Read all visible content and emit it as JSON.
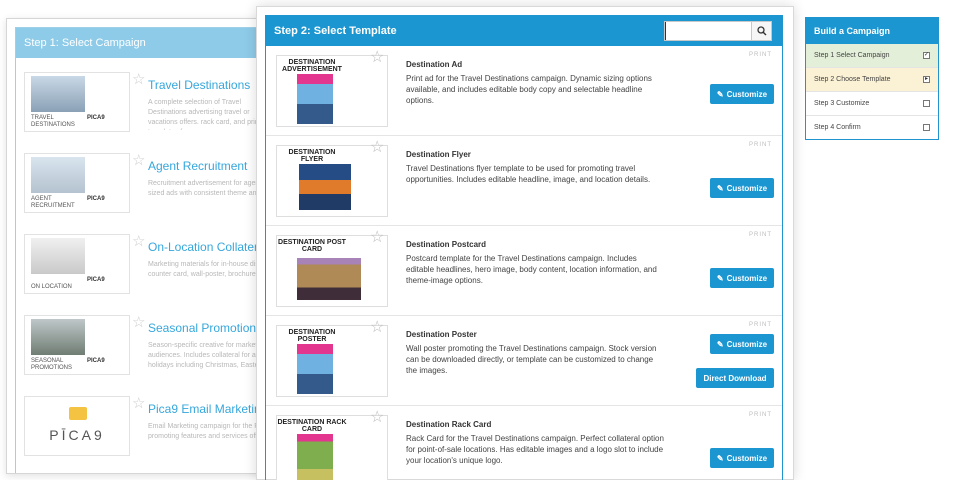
{
  "step1": {
    "header": "Step 1: Select Campaign",
    "campaigns": [
      {
        "title": "Travel Destinations",
        "caption": "TRAVEL DESTINATIONS",
        "brand": "PICA9",
        "desc": "A complete selection of Travel Destinations advertising travel or vacations offers. rack card, and print ad templates for"
      },
      {
        "title": "Agent Recruitment",
        "caption": "AGENT RECRUITMENT",
        "brand": "PICA9",
        "desc": "Recruitment advertisement for agent sized ads with consistent theme and"
      },
      {
        "title": "On-Location Collateral",
        "caption": "ON LOCATION",
        "brand": "PICA9",
        "desc": "Marketing materials for in-house disp counter card, wall-poster, brochure,"
      },
      {
        "title": "Seasonal Promotions",
        "caption": "SEASONAL PROMOTIONS",
        "brand": "PICA9",
        "desc": "Season-specific creative for marketi audiences. Includes collateral for all f holidays including Christmas, Easter"
      },
      {
        "title": "Pica9 Email Marketing",
        "logo_text": "PĪCA9",
        "desc": "Email Marketing campaign for the Pica promoting features and services offe"
      }
    ]
  },
  "step2": {
    "header": "Step 2: Select Template",
    "search": {
      "value": "",
      "placeholder": ""
    },
    "customize_label": "Customize",
    "download_label": "Direct Download",
    "templates": [
      {
        "thumb_title": "DESTINATION ADVERTISEMENT",
        "name": "Destination Ad",
        "tag": "PRINT",
        "desc": "Print ad for the Travel Destinations campaign. Dynamic sizing options available, and includes editable body copy and selectable headline options."
      },
      {
        "thumb_title": "DESTINATION FLYER",
        "name": "Destination Flyer",
        "tag": "PRINT",
        "desc": "Travel Destinations flyer template to be used for promoting travel opportunities. Includes editable headline, image, and location details."
      },
      {
        "thumb_title": "DESTINATION POST CARD",
        "name": "Destination Postcard",
        "tag": "PRINT",
        "desc": "Postcard template for the Travel Destinations campaign. Includes editable headlines, hero image, body content, location information, and theme-image options."
      },
      {
        "thumb_title": "DESTINATION POSTER",
        "name": "Destination Poster",
        "tag": "PRINT",
        "desc": "Wall poster promoting the Travel Destinations campaign. Stock version can be downloaded directly, or template can be customized to change the images."
      },
      {
        "thumb_title": "DESTINATION RACK CARD",
        "name": "Destination Rack Card",
        "tag": "PRINT",
        "desc": "Rack Card for the Travel Destinations campaign. Perfect collateral option for point-of-sale locations. Has editable images and a logo slot to include your location's unique logo."
      }
    ]
  },
  "build": {
    "header": "Build a Campaign",
    "steps": [
      {
        "label": "Step 1 Select Campaign",
        "mark": "✓",
        "state": "done"
      },
      {
        "label": "Step 2 Choose Template",
        "mark": "▸",
        "state": "current"
      },
      {
        "label": "Step 3 Customize",
        "mark": "",
        "state": "todo"
      },
      {
        "label": "Step 4 Confirm",
        "mark": "",
        "state": "todo"
      }
    ]
  }
}
